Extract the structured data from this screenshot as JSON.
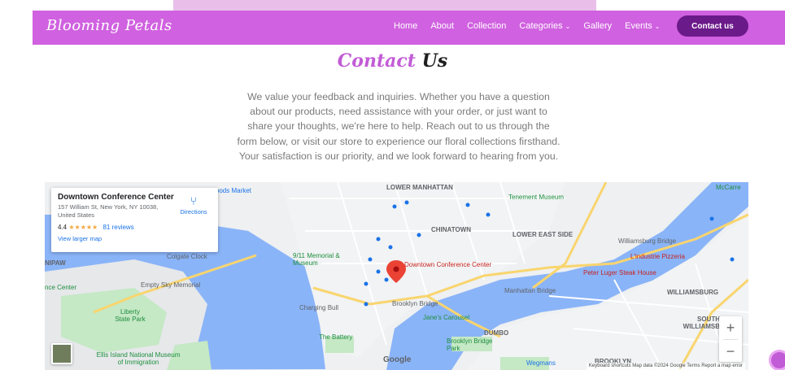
{
  "nav": {
    "brand": "Blooming Petals",
    "items": [
      {
        "label": "Home"
      },
      {
        "label": "About"
      },
      {
        "label": "Collection"
      },
      {
        "label": "Categories",
        "dropdown": true
      },
      {
        "label": "Gallery"
      },
      {
        "label": "Events",
        "dropdown": true
      }
    ],
    "contact_button": "Contact us"
  },
  "heading": {
    "word1": "Contact",
    "word2": "Us"
  },
  "intro_lines": [
    "We value your feedback and inquiries. Whether you have a question",
    "about our products, need assistance with your order, or just want to",
    "share your thoughts, we're here to help. Reach out to us through the",
    "form below, or visit our store to experience our floral collections firsthand.",
    "Your satisfaction is our priority, and we look forward to hearing from you."
  ],
  "map": {
    "place_name": "Downtown Conference Center",
    "address": "157 William St, New York, NY 10038, United States",
    "rating": "4.4",
    "stars": "★★★★★",
    "reviews": "81 reviews",
    "larger_map": "View larger map",
    "directions": "Directions",
    "zoom_in": "+",
    "zoom_out": "−",
    "google": "Google",
    "attribution": "Keyboard shortcuts   Map data ©2024 Google   Terms   Report a map error",
    "pin_label": "Downtown Conference Center",
    "labels": [
      {
        "text": "LOWER MANHATTAN",
        "color": "#5f6368"
      },
      {
        "text": "Tenement Museum",
        "color": "#1e8e3e"
      },
      {
        "text": "CHINATOWN",
        "color": "#5f6368"
      },
      {
        "text": "LOWER EAST SIDE",
        "color": "#5f6368"
      },
      {
        "text": "Williamsburg Bridge",
        "color": "#5f6368"
      },
      {
        "text": "L'industrie Pizzeria",
        "color": "#c5221f"
      },
      {
        "text": "Peter Luger Steak House",
        "color": "#c5221f"
      },
      {
        "text": "WILLIAMSBURG",
        "color": "#5f6368"
      },
      {
        "text": "Manhattan Bridge",
        "color": "#5f6368"
      },
      {
        "text": "Brooklyn Bridge",
        "color": "#5f6368"
      },
      {
        "text": "Jane's Carousel",
        "color": "#1e8e3e"
      },
      {
        "text": "DUMBO",
        "color": "#5f6368"
      },
      {
        "text": "Brooklyn Bridge Park",
        "color": "#1e8e3e"
      },
      {
        "text": "Charging Bull",
        "color": "#5f6368"
      },
      {
        "text": "The Battery",
        "color": "#1e8e3e"
      },
      {
        "text": "9/11 Memorial & Museum",
        "color": "#1e8e3e"
      },
      {
        "text": "Colgate Clock",
        "color": "#5f6368"
      },
      {
        "text": "Empty Sky Memorial",
        "color": "#5f6368"
      },
      {
        "text": "Liberty State Park",
        "color": "#1e8e3e"
      },
      {
        "text": "Ellis Island National Museum of Immigration",
        "color": "#1e8e3e"
      },
      {
        "text": "Wegmans",
        "color": "#1a73e8"
      },
      {
        "text": "SOUTH WILLIAMSB",
        "color": "#5f6368"
      },
      {
        "text": "BROOKLYN",
        "color": "#5f6368"
      },
      {
        "text": "McCarre",
        "color": "#1e8e3e"
      },
      {
        "text": "NIPAW",
        "color": "#5f6368"
      },
      {
        "text": "Foods Market",
        "color": "#1a73e8"
      },
      {
        "text": "nce Center",
        "color": "#1e8e3e"
      }
    ]
  }
}
